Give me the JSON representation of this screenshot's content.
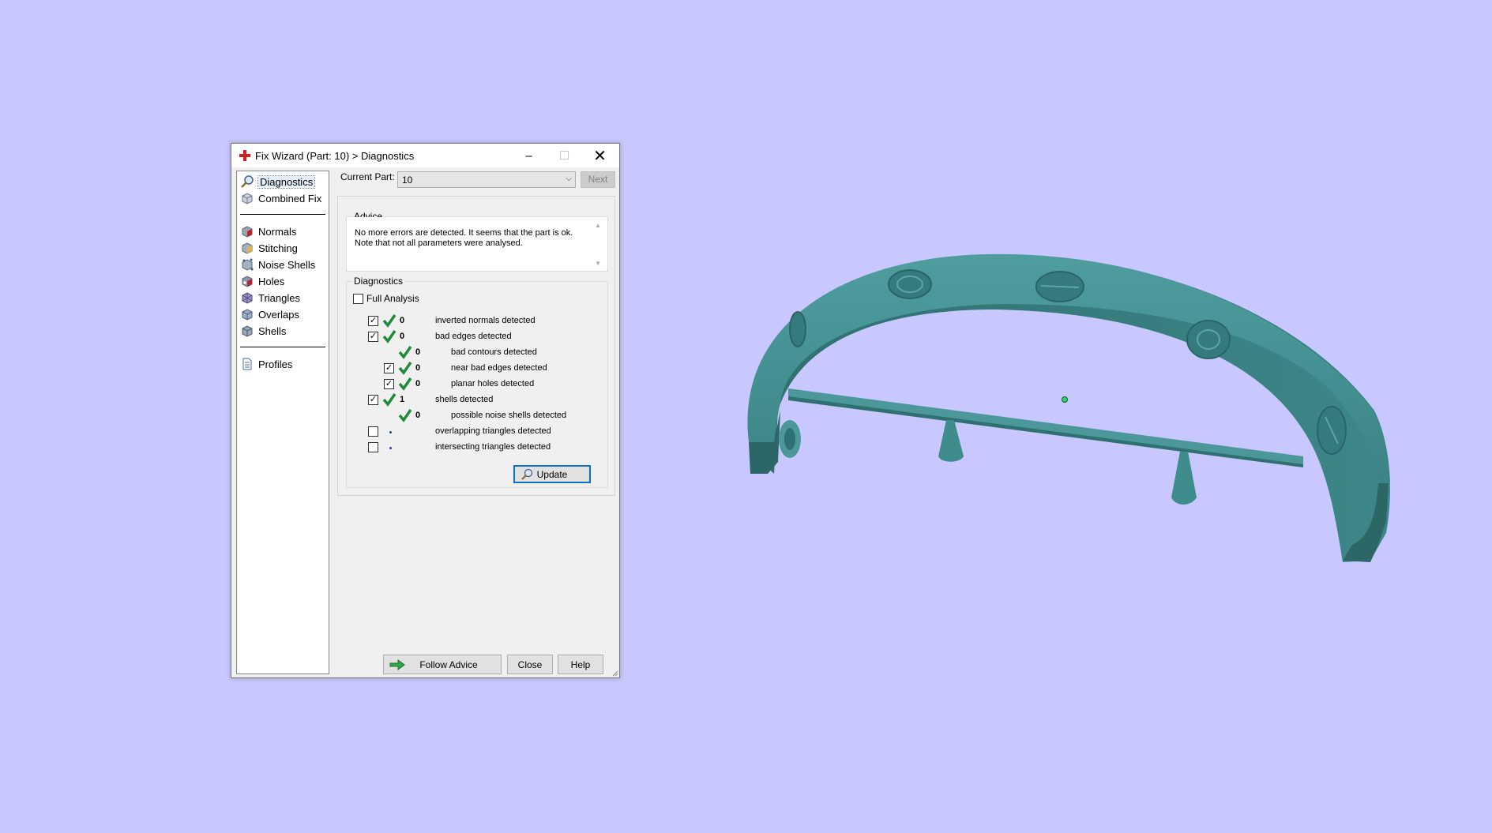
{
  "window": {
    "title": "Fix Wizard (Part: 10) > Diagnostics",
    "minimize": "–",
    "maximize": "☐",
    "close": "✕"
  },
  "nav": {
    "group1": [
      {
        "label": "Diagnostics",
        "icon": "magnifier-icon",
        "selected": true
      },
      {
        "label": "Combined Fix",
        "icon": "box-icon"
      }
    ],
    "group2": [
      {
        "label": "Normals",
        "icon": "normals-cube-icon"
      },
      {
        "label": "Stitching",
        "icon": "stitching-cube-icon"
      },
      {
        "label": "Noise Shells",
        "icon": "noise-shells-icon"
      },
      {
        "label": "Holes",
        "icon": "holes-cube-icon"
      },
      {
        "label": "Triangles",
        "icon": "triangles-cube-icon"
      },
      {
        "label": "Overlaps",
        "icon": "overlaps-cube-icon"
      },
      {
        "label": "Shells",
        "icon": "shells-cube-icon"
      }
    ],
    "group3": [
      {
        "label": "Profiles",
        "icon": "document-icon"
      }
    ]
  },
  "toolbar": {
    "current_part_label": "Current Part:",
    "current_part_value": "10",
    "next_label": "Next"
  },
  "advice": {
    "title": "Advice",
    "line1": "No more errors are detected. It seems that the part is ok.",
    "line2": "Note that not all parameters were analysed."
  },
  "diagnostics": {
    "title": "Diagnostics",
    "full_analysis_label": "Full Analysis",
    "full_analysis_checked": false,
    "rows": [
      {
        "checkbox": true,
        "checked": true,
        "status": "ok",
        "count": "0",
        "label": "inverted normals detected",
        "indent": 0
      },
      {
        "checkbox": true,
        "checked": true,
        "status": "ok",
        "count": "0",
        "label": "bad edges detected",
        "indent": 0
      },
      {
        "checkbox": false,
        "checked": false,
        "status": "ok",
        "count": "0",
        "label": "bad contours detected",
        "indent": 1
      },
      {
        "checkbox": true,
        "checked": true,
        "status": "ok",
        "count": "0",
        "label": "near bad edges detected",
        "indent": 1
      },
      {
        "checkbox": true,
        "checked": true,
        "status": "ok",
        "count": "0",
        "label": "planar holes detected",
        "indent": 1
      },
      {
        "checkbox": true,
        "checked": true,
        "status": "ok",
        "count": "1",
        "label": "shells detected",
        "indent": 0
      },
      {
        "checkbox": false,
        "checked": false,
        "status": "ok",
        "count": "0",
        "label": "possible noise shells detected",
        "indent": 1
      },
      {
        "checkbox": true,
        "checked": false,
        "status": "none",
        "count": "",
        "label": "overlapping triangles detected",
        "indent": 0
      },
      {
        "checkbox": true,
        "checked": false,
        "status": "none",
        "count": "",
        "label": "intersecting triangles detected",
        "indent": 0
      }
    ],
    "update_label": "Update"
  },
  "footer": {
    "follow_advice_label": "Follow Advice",
    "close_label": "Close",
    "help_label": "Help"
  },
  "colors": {
    "background": "#c8c8fe",
    "model": "#3f8c8c",
    "check_green": "#1f8a3c",
    "focus_blue": "#0a6fcf"
  }
}
